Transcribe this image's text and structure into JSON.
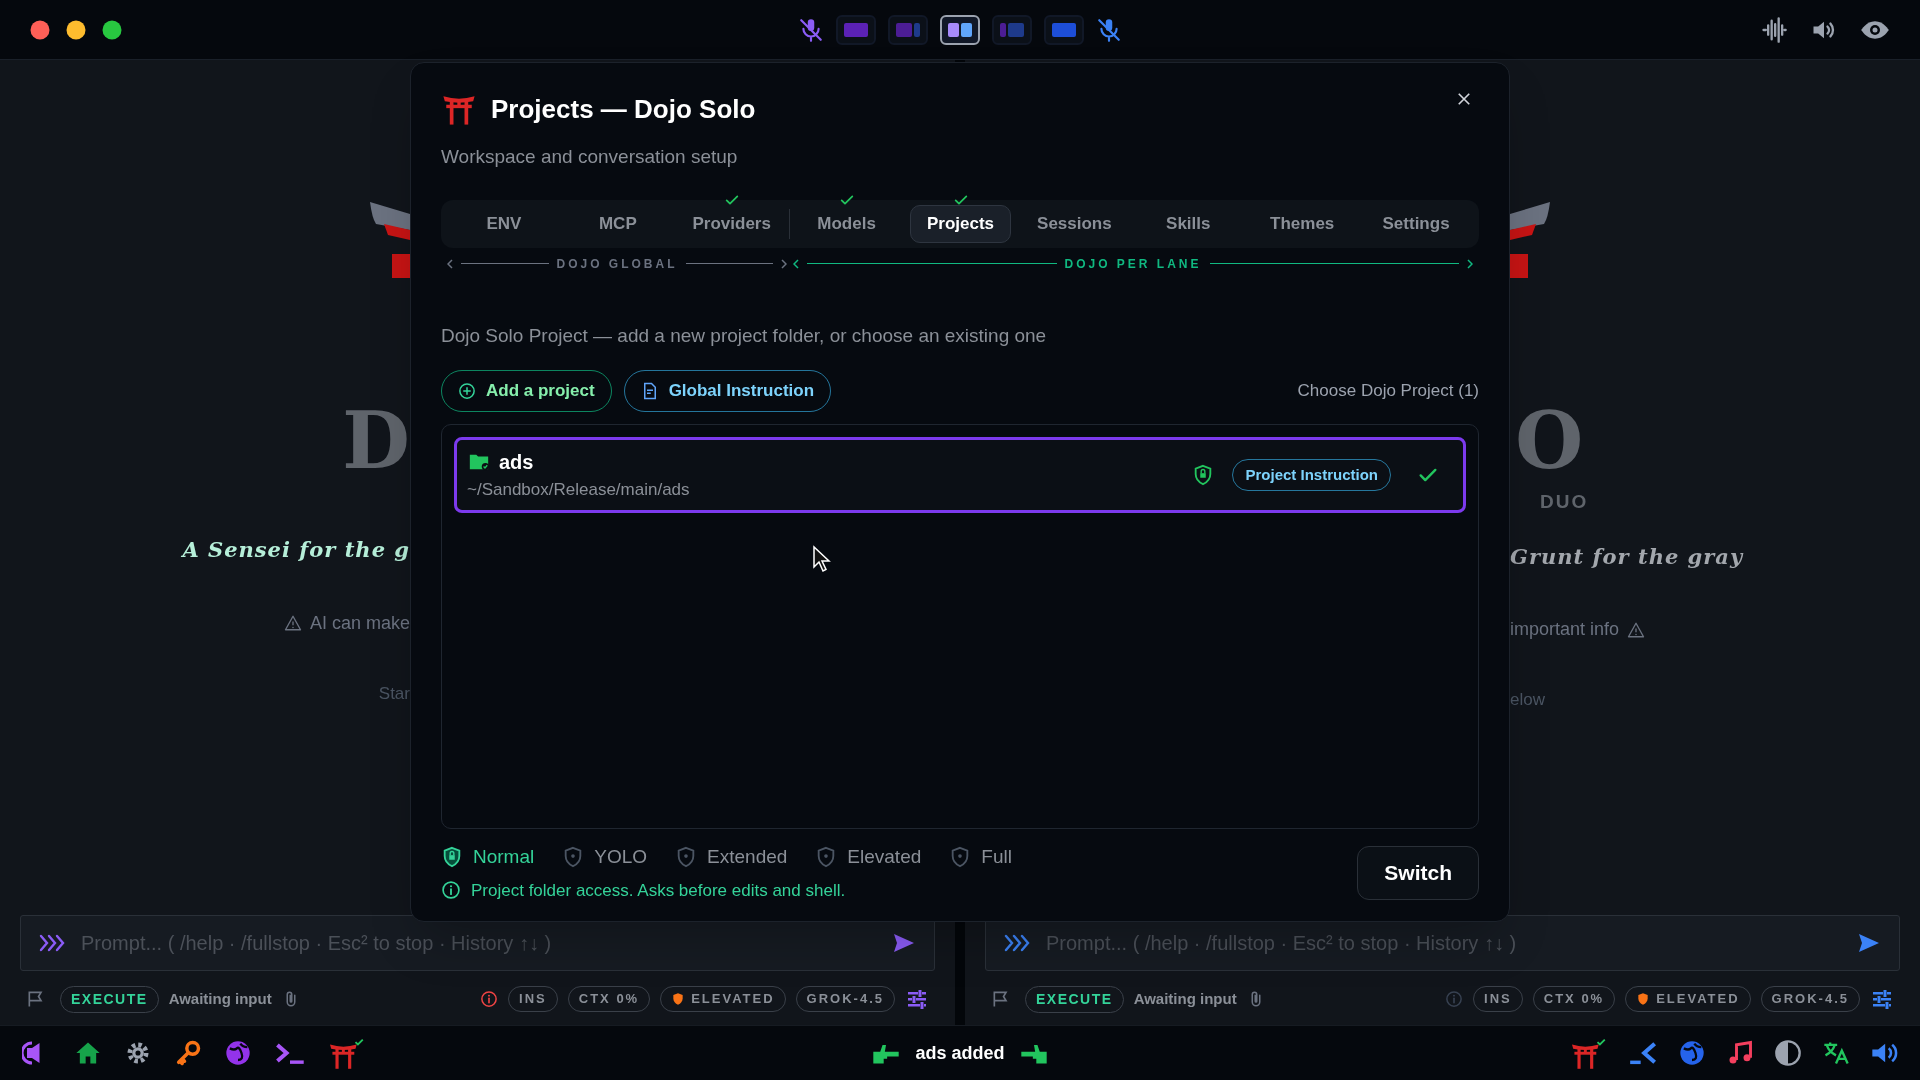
{
  "top_bar": {
    "layouts": [
      {
        "selected": false
      },
      {
        "selected": false
      },
      {
        "selected": true
      },
      {
        "selected": false
      },
      {
        "selected": false
      }
    ]
  },
  "panes": [
    {
      "logo_letter": "D",
      "tagline": "A Sensei for the g",
      "tagline_active": true,
      "warning": "AI can make",
      "hint": "Star",
      "color": "#8b5cf6",
      "prompt": {
        "placeholder": "Prompt... ( /help · /fullstop · Esc² to stop · History ↑↓ )"
      },
      "status": {
        "mode": "EXECUTE",
        "state": "Awaiting input",
        "alert": true,
        "pills": [
          {
            "label": "INS",
            "kind": "plain"
          },
          {
            "label": "CTX 0%",
            "kind": "plain"
          },
          {
            "label": "ELEVATED",
            "kind": "elevated"
          },
          {
            "label": "GROK-4.5",
            "kind": "plain"
          }
        ]
      }
    },
    {
      "logo_letter": "O",
      "logo_caption": "DUO",
      "tagline": "Grunt for the gray",
      "tagline_active": false,
      "warning": "important info",
      "hint": "elow",
      "color": "#3b82f6",
      "prompt": {
        "placeholder": "Prompt... ( /help · /fullstop · Esc² to stop · History ↑↓ )"
      },
      "status": {
        "mode": "EXECUTE",
        "state": "Awaiting input",
        "alert": false,
        "pills": [
          {
            "label": "INS",
            "kind": "plain"
          },
          {
            "label": "CTX 0%",
            "kind": "plain"
          },
          {
            "label": "ELEVATED",
            "kind": "elevated"
          },
          {
            "label": "GROK-4.5",
            "kind": "plain"
          }
        ]
      }
    }
  ],
  "dialog": {
    "title": "Projects — Dojo Solo",
    "subtitle": "Workspace and conversation setup",
    "tab_groups": [
      {
        "label": "DOJO GLOBAL",
        "active": false,
        "tabs": [
          {
            "label": "ENV",
            "selected": false,
            "checked": false
          },
          {
            "label": "MCP",
            "selected": false,
            "checked": false
          },
          {
            "label": "Providers",
            "selected": false,
            "checked": true
          }
        ]
      },
      {
        "label": "DOJO PER LANE",
        "active": true,
        "tabs": [
          {
            "label": "Models",
            "selected": false,
            "checked": true
          },
          {
            "label": "Projects",
            "selected": true,
            "checked": true
          },
          {
            "label": "Sessions",
            "selected": false,
            "checked": false
          },
          {
            "label": "Skills",
            "selected": false,
            "checked": false
          },
          {
            "label": "Themes",
            "selected": false,
            "checked": false
          },
          {
            "label": "Settings",
            "selected": false,
            "checked": false
          }
        ]
      }
    ],
    "description": "Dojo Solo Project — add a new project folder, or choose an existing one",
    "buttons": [
      {
        "kind": "add",
        "label": "Add a project"
      },
      {
        "kind": "instruction",
        "label": "Global Instruction"
      }
    ],
    "count_label": "Choose Dojo Project (1)",
    "projects": [
      {
        "name": "ads",
        "path": "~/Sandbox/Release/main/ads",
        "selected": true,
        "instruction_label": "Project Instruction",
        "checked": true
      }
    ],
    "modes": [
      {
        "label": "Normal",
        "selected": true
      },
      {
        "label": "YOLO",
        "selected": false
      },
      {
        "label": "Extended",
        "selected": false
      },
      {
        "label": "Elevated",
        "selected": false
      },
      {
        "label": "Full",
        "selected": false
      }
    ],
    "mode_hint": "Project folder access. Asks before edits and shell.",
    "confirm_label": "Switch"
  },
  "notification": {
    "text": "ads added"
  }
}
